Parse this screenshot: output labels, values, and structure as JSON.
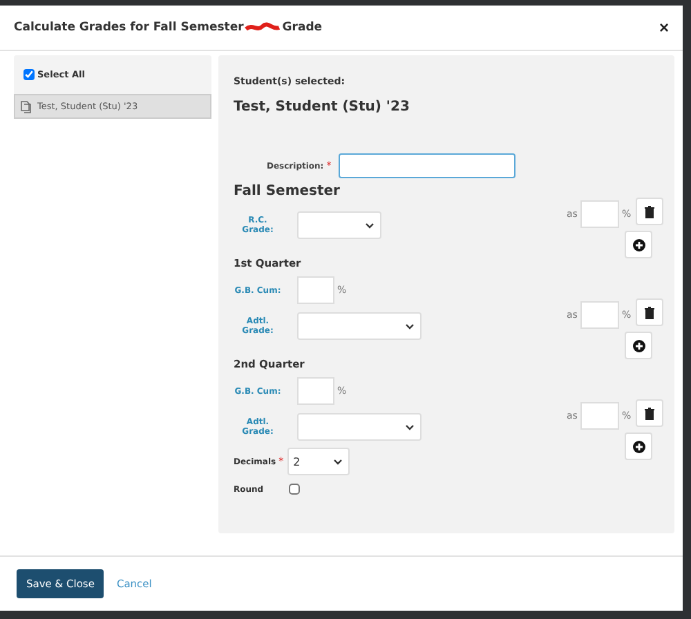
{
  "dialog": {
    "title": "Calculate Grades for Fall Semester",
    "title_end": "Grade",
    "close": "×"
  },
  "students": {
    "select_all": {
      "label": "Select All",
      "checked": true
    },
    "items": [
      {
        "name": "Test, Student (Stu) '23",
        "selected": true
      }
    ]
  },
  "selection": {
    "heading": "Student(s) selected:",
    "names": "Test, Student (Stu) '23"
  },
  "description": {
    "label": "Description:",
    "required_mark": "*"
  },
  "sections": [
    {
      "title": "Fall Semester",
      "major": true,
      "rows": [
        {
          "kind": "grade",
          "label": "R.C. Grade:",
          "as": "as",
          "unit": "%"
        }
      ]
    },
    {
      "title": "1st Quarter",
      "major": false,
      "rows": [
        {
          "kind": "percent",
          "label": "G.B. Cum:",
          "unit": "%"
        },
        {
          "kind": "adjusted",
          "label": "Adtl. Grade:",
          "as": "as",
          "unit": "%"
        }
      ]
    },
    {
      "title": "2nd Quarter",
      "major": false,
      "rows": [
        {
          "kind": "percent",
          "label": "G.B. Cum:",
          "unit": "%"
        },
        {
          "kind": "adjusted",
          "label": "Adtl. Grade:",
          "as": "as",
          "unit": "%"
        }
      ]
    }
  ],
  "decimals": {
    "label": "Decimals",
    "required_mark": "*",
    "value": "2"
  },
  "round": {
    "label": "Round",
    "checked": false
  },
  "footer": {
    "save": "Save & Close",
    "cancel": "Cancel"
  }
}
